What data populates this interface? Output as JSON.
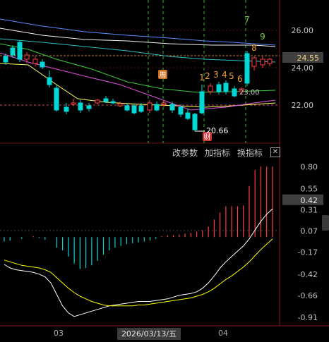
{
  "chart_data": [
    {
      "type": "candlestick",
      "price_axis_ticks": [
        "26.00",
        "24.00",
        "22.00"
      ],
      "current_price": "24.55",
      "low_price": 20.66,
      "low_label": "20.66",
      "ref_label": "23.00",
      "countdown_labels": [
        "1",
        "2",
        "3",
        "4",
        "5",
        "6",
        "7",
        "8",
        "9"
      ],
      "markers": [
        {
          "label": "周",
          "kind": "week"
        },
        {
          "label": "财",
          "kind": "finance"
        }
      ]
    },
    {
      "type": "bar",
      "indicator": "MACD",
      "axis_ticks": [
        "0.80",
        "0.55",
        "0.31",
        "0.07",
        "-0.17",
        "-0.42",
        "-0.66",
        "-0.91"
      ],
      "current_value": "0.42",
      "ylim": [
        -0.95,
        0.85
      ],
      "histogram": [
        -0.05,
        -0.04,
        0.0,
        -0.02,
        0.0,
        0.01,
        -0.01,
        -0.03,
        0.0,
        -0.12,
        -0.15,
        -0.22,
        -0.3,
        -0.36,
        -0.35,
        -0.32,
        -0.27,
        -0.2,
        -0.15,
        -0.12,
        -0.1,
        -0.08,
        -0.07,
        -0.06,
        -0.05,
        -0.04,
        -0.02,
        0.01,
        0.02,
        0.02,
        0.03,
        0.04,
        0.05,
        0.06,
        0.08,
        0.12,
        0.2,
        0.28,
        0.35,
        0.35,
        0.35,
        0.36,
        0.58,
        0.76,
        0.8,
        0.8,
        0.8
      ],
      "dif": [
        -0.31,
        -0.35,
        -0.37,
        -0.38,
        -0.39,
        -0.4,
        -0.42,
        -0.45,
        -0.52,
        -0.65,
        -0.78,
        -0.86,
        -0.9,
        -0.88,
        -0.86,
        -0.84,
        -0.82,
        -0.8,
        -0.78,
        -0.77,
        -0.76,
        -0.75,
        -0.74,
        -0.73,
        -0.73,
        -0.73,
        -0.72,
        -0.71,
        -0.7,
        -0.68,
        -0.66,
        -0.65,
        -0.64,
        -0.62,
        -0.58,
        -0.52,
        -0.44,
        -0.35,
        -0.28,
        -0.22,
        -0.16,
        -0.1,
        -0.02,
        0.08,
        0.18,
        0.26,
        0.32
      ],
      "dea": [
        -0.26,
        -0.28,
        -0.3,
        -0.32,
        -0.33,
        -0.34,
        -0.35,
        -0.37,
        -0.4,
        -0.46,
        -0.52,
        -0.58,
        -0.63,
        -0.67,
        -0.7,
        -0.73,
        -0.75,
        -0.77,
        -0.78,
        -0.78,
        -0.78,
        -0.78,
        -0.78,
        -0.77,
        -0.77,
        -0.76,
        -0.75,
        -0.74,
        -0.73,
        -0.72,
        -0.71,
        -0.7,
        -0.69,
        -0.67,
        -0.65,
        -0.62,
        -0.58,
        -0.53,
        -0.48,
        -0.44,
        -0.39,
        -0.34,
        -0.28,
        -0.21,
        -0.14,
        -0.08,
        -0.02
      ]
    }
  ],
  "toolbar": {
    "change_params": "改参数",
    "add_indicator": "加指标",
    "switch_indicator": "换指标",
    "close": "✕"
  },
  "time_axis": {
    "label_03": "03",
    "label_04": "04",
    "cursor_date": "2026/03/13/五"
  },
  "colors": {
    "up": "#ff4040",
    "down": "#00d8d8",
    "dif": "#ffffff",
    "dea": "#ffff00",
    "bg": "#000000",
    "grid": "#8b0000"
  }
}
